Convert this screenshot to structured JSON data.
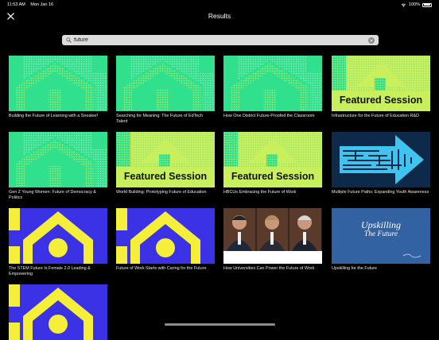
{
  "status": {
    "time": "11:53 AM",
    "date": "Mon Jan 16",
    "battery": "100%"
  },
  "nav": {
    "title": "Results"
  },
  "search": {
    "value": "future",
    "placeholder": "Search"
  },
  "colors": {
    "green": "#31e08d",
    "lime": "#c8f05c",
    "blue": "#3b32e6",
    "yellow": "#f5ef3a",
    "navy": "#0e2a4a",
    "cyan": "#3fc4ef"
  },
  "results": [
    {
      "title": "Building the Future of Learning with a Sneaker!",
      "thumb": "green-house"
    },
    {
      "title": "Searching for Meaning: The Future of EdTech Talent",
      "thumb": "green-house"
    },
    {
      "title": "How One District Future-Proofed the Classroom",
      "thumb": "green-house"
    },
    {
      "title": "Infrastructure for the Future of Education R&D",
      "thumb": "featured",
      "badge": "Featured Session"
    },
    {
      "title": "Gen Z Young Women: Future of Democracy & Politics",
      "thumb": "green-house"
    },
    {
      "title": "World Building: Prototyping Future of Education",
      "thumb": "featured",
      "badge": "Featured Session"
    },
    {
      "title": "HBCUs Embracing the Future of Work",
      "thumb": "featured",
      "badge": "Featured Session"
    },
    {
      "title": "Multiple Future Paths: Expanding Youth Awareness",
      "thumb": "maze-arrow"
    },
    {
      "title": "The STEM Future Is Female 2.0 Leading & Empowering",
      "thumb": "blue-house"
    },
    {
      "title": "Future of Work Starts with Caring for the Future",
      "thumb": "blue-house"
    },
    {
      "title": "How Universities Can Power the Future of Work",
      "thumb": "panel-photo"
    },
    {
      "title": "Upskilling for the Future",
      "thumb": "book-cover",
      "cover_line1": "Upskilling",
      "cover_line2": "The Future"
    },
    {
      "title": "",
      "thumb": "blue-house"
    }
  ]
}
